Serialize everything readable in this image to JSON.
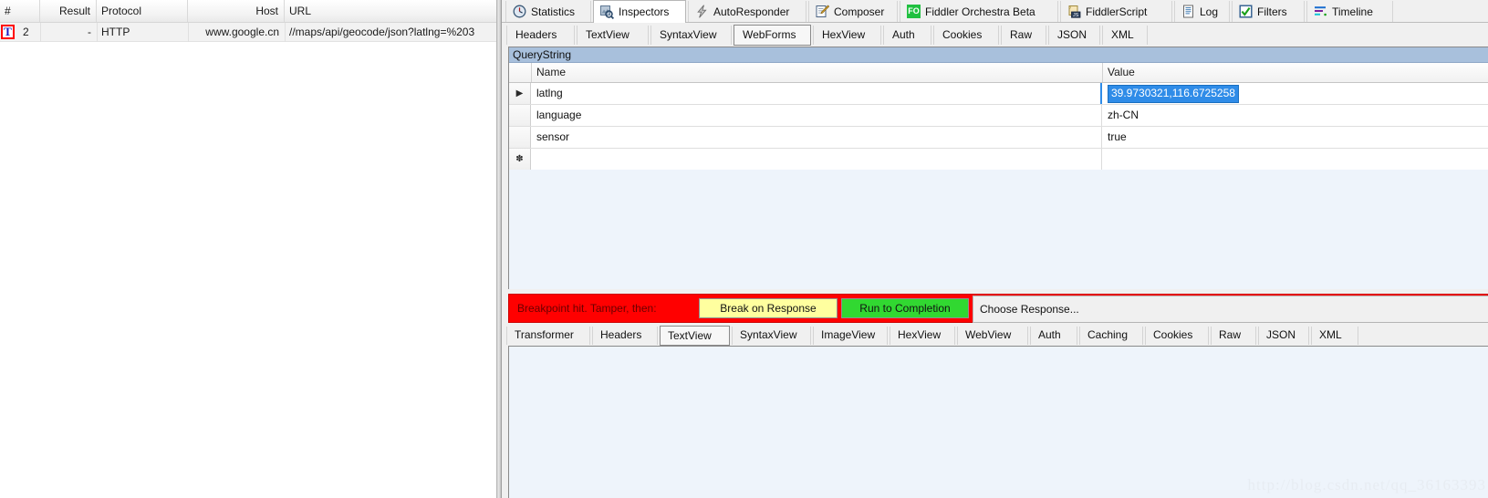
{
  "accent": {
    "breakpoint_red": "#ff0000",
    "break_on_response_yellow": "#ffff9f",
    "run_to_completion_green": "#31d831",
    "selection_blue": "#2f8ce8",
    "group_header_blue": "#a8c0dc",
    "orchestra_green": "#20c040"
  },
  "session_list": {
    "columns": [
      {
        "label": "#",
        "align": "left"
      },
      {
        "label": "Result",
        "align": "right"
      },
      {
        "label": "Protocol",
        "align": "left"
      },
      {
        "label": "Host",
        "align": "right"
      },
      {
        "label": "URL",
        "align": "left"
      }
    ],
    "rows": [
      {
        "breakpoint_icon": "breakpoint-tamper-icon",
        "breakpoint_glyph": "T",
        "num": "2",
        "result": "-",
        "protocol": "HTTP",
        "host": "www.google.cn",
        "url": "//maps/api/geocode/json?latlng=%203"
      }
    ]
  },
  "main_tabs": [
    {
      "label": "Statistics",
      "icon": "clock-statistics-icon",
      "selected": false
    },
    {
      "label": "Inspectors",
      "icon": "magnifier-inspectors-icon",
      "selected": true
    },
    {
      "label": "AutoResponder",
      "icon": "lightning-bolt-icon",
      "selected": false
    },
    {
      "label": "Composer",
      "icon": "pencil-note-icon",
      "selected": false
    },
    {
      "label": "Fiddler Orchestra Beta",
      "icon": "fo-badge-icon",
      "selected": false
    },
    {
      "label": "FiddlerScript",
      "icon": "js-scroll-icon",
      "selected": false
    },
    {
      "label": "Log",
      "icon": "document-log-icon",
      "selected": false
    },
    {
      "label": "Filters",
      "icon": "checkbox-checked-icon",
      "selected": false
    },
    {
      "label": "Timeline",
      "icon": "timeline-bars-icon",
      "selected": false
    }
  ],
  "request_tabs": [
    {
      "label": "Headers",
      "selected": false
    },
    {
      "label": "TextView",
      "selected": false
    },
    {
      "label": "SyntaxView",
      "selected": false
    },
    {
      "label": "WebForms",
      "selected": true
    },
    {
      "label": "HexView",
      "selected": false
    },
    {
      "label": "Auth",
      "selected": false
    },
    {
      "label": "Cookies",
      "selected": false
    },
    {
      "label": "Raw",
      "selected": false
    },
    {
      "label": "JSON",
      "selected": false
    },
    {
      "label": "XML",
      "selected": false
    }
  ],
  "webforms": {
    "group_title": "QueryString",
    "columns": {
      "name": "Name",
      "value": "Value"
    },
    "rows": [
      {
        "row_marker": "▶",
        "name": "latlng",
        "value": "39.9730321,116.6725258",
        "editing": true
      },
      {
        "row_marker": "",
        "name": "language",
        "value": "zh-CN",
        "editing": false
      },
      {
        "row_marker": "",
        "name": "sensor",
        "value": "true",
        "editing": false
      },
      {
        "row_marker": "✽",
        "name": "",
        "value": "",
        "editing": false
      }
    ]
  },
  "breakpoint_bar": {
    "message": "Breakpoint hit. Tamper, then:",
    "break_on_response_label": "Break on Response",
    "run_to_completion_label": "Run to Completion",
    "choose_response_label": "Choose Response..."
  },
  "response_tabs": [
    {
      "label": "Transformer",
      "selected": false
    },
    {
      "label": "Headers",
      "selected": false
    },
    {
      "label": "TextView",
      "selected": true
    },
    {
      "label": "SyntaxView",
      "selected": false
    },
    {
      "label": "ImageView",
      "selected": false
    },
    {
      "label": "HexView",
      "selected": false
    },
    {
      "label": "WebView",
      "selected": false
    },
    {
      "label": "Auth",
      "selected": false
    },
    {
      "label": "Caching",
      "selected": false
    },
    {
      "label": "Cookies",
      "selected": false
    },
    {
      "label": "Raw",
      "selected": false
    },
    {
      "label": "JSON",
      "selected": false
    },
    {
      "label": "XML",
      "selected": false
    }
  ],
  "response_body": {
    "text": ""
  },
  "watermark": {
    "text": "http://blog.csdn.net/qq_36163393"
  }
}
